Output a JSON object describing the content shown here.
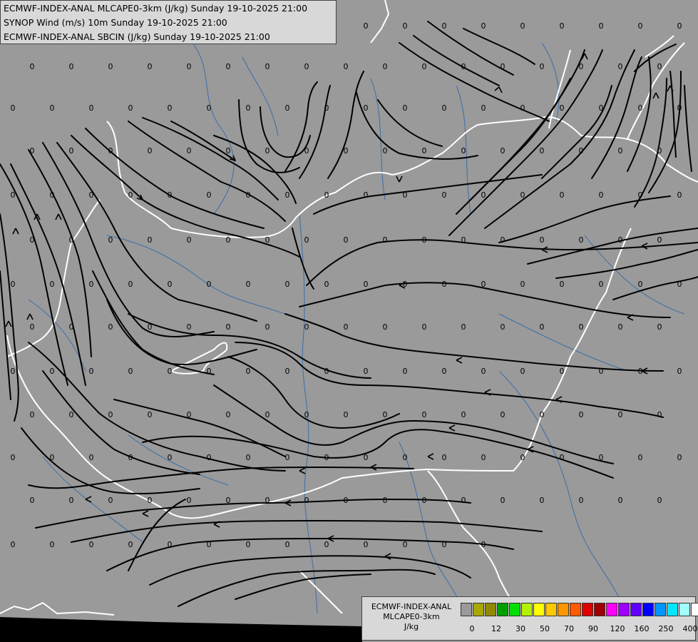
{
  "header": {
    "line1": "ECMWF-INDEX-ANAL MLCAPE0-3km (J/kg) Sunday 19-10-2025 21:00",
    "line2": "SYNOP Wind (m/s) 10m Sunday 19-10-2025 21:00",
    "line3": "ECMWF-INDEX-ANAL SBCIN (J/kg) Sunday 19-10-2025 21:00"
  },
  "legend": {
    "title1": "ECMWF-INDEX-ANAL",
    "title2": "MLCAPE0-3km",
    "unit": "J/kg",
    "colors": [
      "#9a9a9a",
      "#a8a800",
      "#908a00",
      "#00a000",
      "#00e000",
      "#b4f000",
      "#ffff00",
      "#ffc800",
      "#ff9600",
      "#ff5a00",
      "#e00000",
      "#a00000",
      "#ff00ff",
      "#a000ff",
      "#6000ff",
      "#0000ff",
      "#0096ff",
      "#00e6ff",
      "#a0ffff",
      "#ffffff"
    ],
    "ticks": [
      {
        "label": "0",
        "index": 1
      },
      {
        "label": "12",
        "index": 3
      },
      {
        "label": "30",
        "index": 5
      },
      {
        "label": "50",
        "index": 7
      },
      {
        "label": "70",
        "index": 9
      },
      {
        "label": "90",
        "index": 11
      },
      {
        "label": "120",
        "index": 13
      },
      {
        "label": "160",
        "index": 15
      },
      {
        "label": "250",
        "index": 17
      },
      {
        "label": "400",
        "index": 19
      }
    ]
  },
  "map": {
    "background_color": "#9a9a9a",
    "border_color": "#ffffff",
    "river_color": "#3a6ea8",
    "streamline_color": "#000000",
    "cape_value_label": "0",
    "cape_value_count": 214
  }
}
